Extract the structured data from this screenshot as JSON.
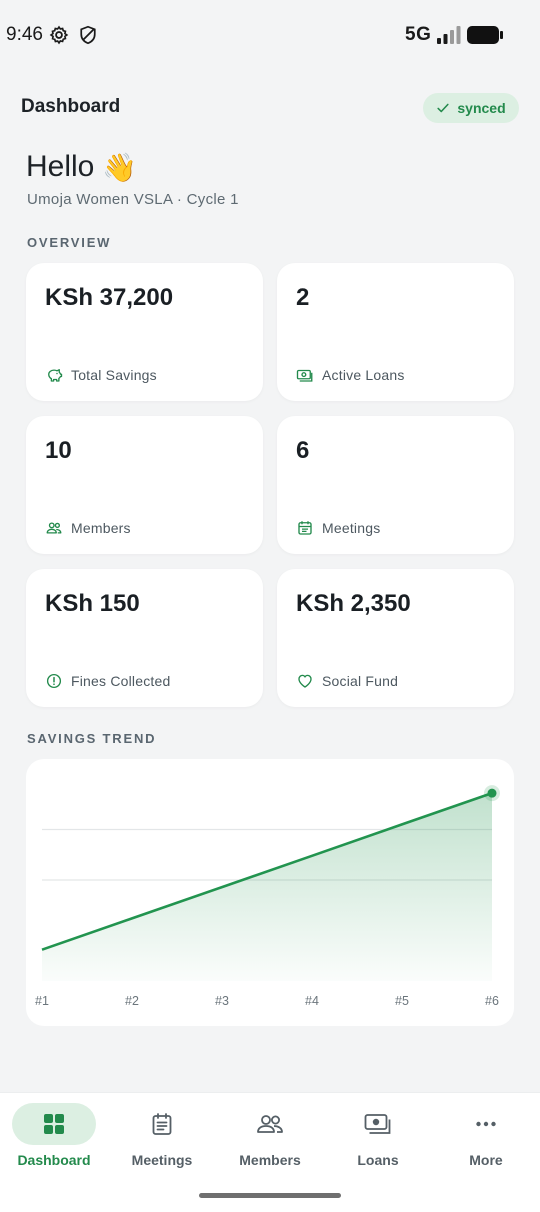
{
  "status_bar": {
    "time": "9:46",
    "network": "5G"
  },
  "header": {
    "title": "Dashboard",
    "sync_label": "synced"
  },
  "greeting": {
    "text": "Hello",
    "emoji": "👋",
    "group": "Umoja Women VSLA · Cycle 1"
  },
  "overview": {
    "label": "OVERVIEW",
    "cards": [
      {
        "value": "KSh 37,200",
        "label": "Total Savings",
        "icon": "piggy-bank-icon"
      },
      {
        "value": "2",
        "label": "Active Loans",
        "icon": "cash-icon"
      },
      {
        "value": "10",
        "label": "Members",
        "icon": "members-icon"
      },
      {
        "value": "6",
        "label": "Meetings",
        "icon": "calendar-icon"
      },
      {
        "value": "KSh 150",
        "label": "Fines Collected",
        "icon": "alert-circle-icon"
      },
      {
        "value": "KSh 2,350",
        "label": "Social Fund",
        "icon": "heart-icon"
      }
    ]
  },
  "trend": {
    "label": "SAVINGS TREND"
  },
  "chart_data": {
    "type": "area",
    "categories": [
      "#1",
      "#2",
      "#3",
      "#4",
      "#5",
      "#6"
    ],
    "values": [
      6200,
      12400,
      18600,
      24800,
      31000,
      37200
    ],
    "ylim": [
      0,
      40000
    ],
    "grid": true,
    "color": "#22944f"
  },
  "nav": {
    "items": [
      {
        "label": "Dashboard",
        "icon": "grid-icon",
        "active": true
      },
      {
        "label": "Meetings",
        "icon": "clipboard-icon",
        "active": false
      },
      {
        "label": "Members",
        "icon": "people-icon",
        "active": false
      },
      {
        "label": "Loans",
        "icon": "cash-icon",
        "active": false
      },
      {
        "label": "More",
        "icon": "more-icon",
        "active": false
      }
    ]
  },
  "colors": {
    "accent": "#238a4c",
    "accent_soft": "#dcefe2",
    "background": "#f3f4f5"
  }
}
